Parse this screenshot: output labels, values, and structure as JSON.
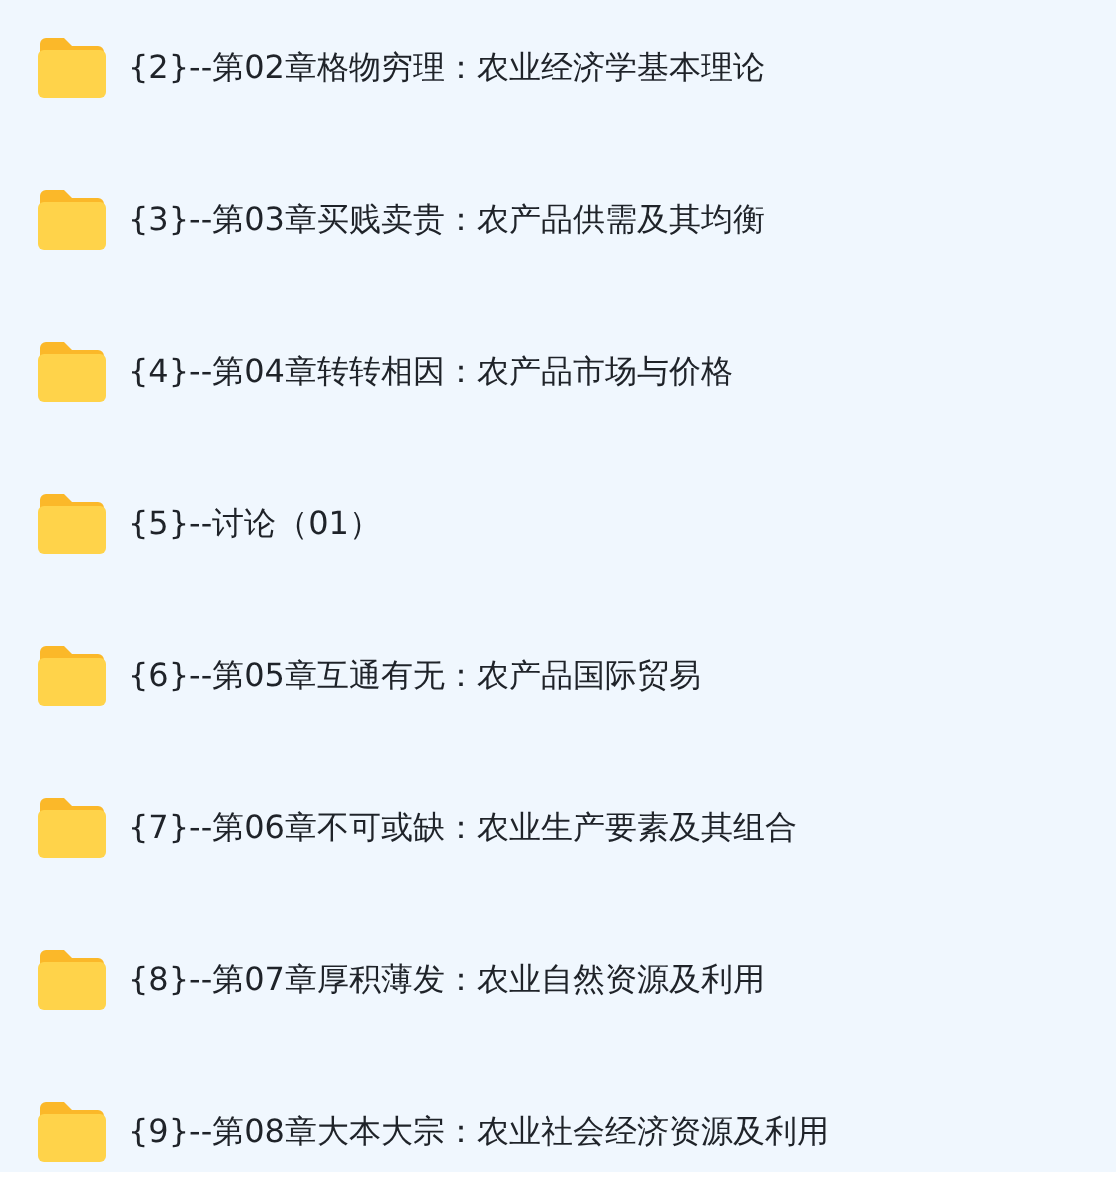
{
  "folders": [
    {
      "name": "{2}--第02章格物穷理：农业经济学基本理论"
    },
    {
      "name": "{3}--第03章买贱卖贵：农产品供需及其均衡"
    },
    {
      "name": "{4}--第04章转转相因：农产品市场与价格"
    },
    {
      "name": "{5}--讨论（01）"
    },
    {
      "name": "{6}--第05章互通有无：农产品国际贸易"
    },
    {
      "name": "{7}--第06章不可或缺：农业生产要素及其组合"
    },
    {
      "name": "{8}--第07章厚积薄发：农业自然资源及利用"
    },
    {
      "name": "{9}--第08章大本大宗：农业社会经济资源及利用"
    }
  ]
}
